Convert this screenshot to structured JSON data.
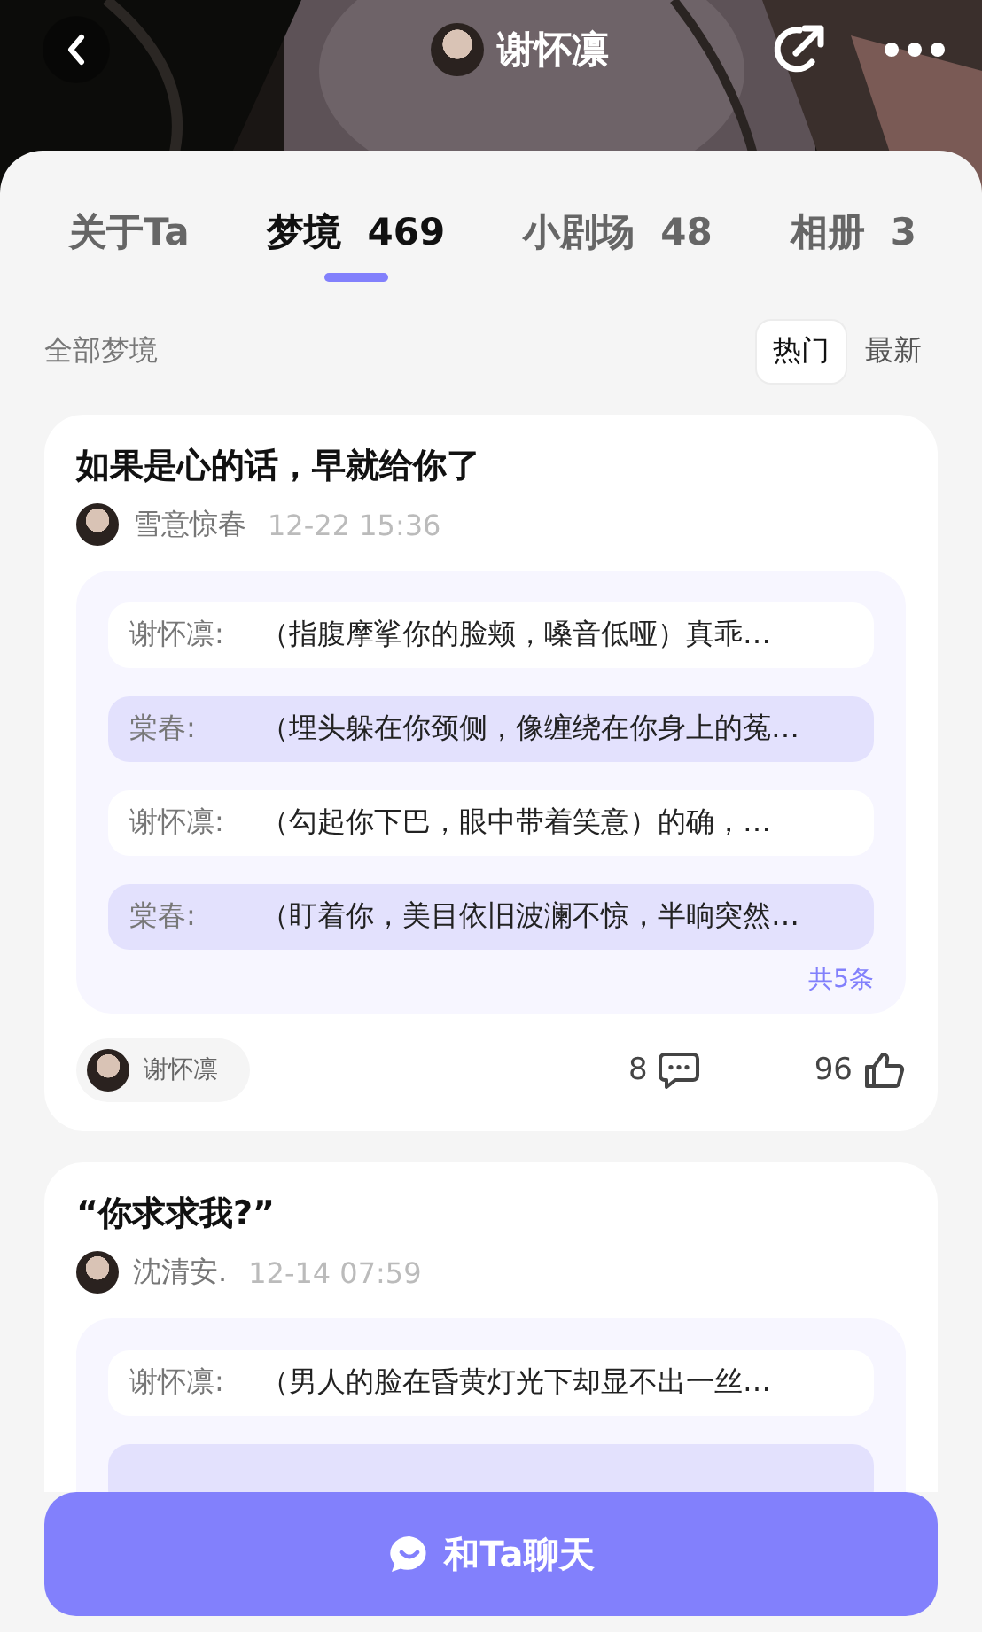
{
  "header": {
    "title": "谢怀凛"
  },
  "tabs": [
    {
      "label": "关于Ta",
      "selected": false
    },
    {
      "label": "梦境",
      "count": "469",
      "selected": true
    },
    {
      "label": "小剧场",
      "count": "48",
      "selected": false
    },
    {
      "label": "相册",
      "count": "3",
      "selected": false
    }
  ],
  "filter": {
    "label": "全部梦境",
    "sorts": [
      {
        "label": "热门",
        "selected": true
      },
      {
        "label": "最新",
        "selected": false
      }
    ]
  },
  "posts": [
    {
      "title": "如果是心的话，早就给你了",
      "author": "雪意惊春",
      "time": "12-22 15:36",
      "lines": [
        {
          "kind": "character",
          "speaker": "谢怀凛:",
          "text": "（指腹摩挲你的脸颊，嗓音低哑）真乖…"
        },
        {
          "kind": "user",
          "speaker": "棠春:",
          "text": "（埋头躲在你颈侧，像缠绕在你身上的菟…"
        },
        {
          "kind": "character",
          "speaker": "谢怀凛:",
          "text": "（勾起你下巴，眼中带着笑意）的确，…"
        },
        {
          "kind": "user",
          "speaker": "棠春:",
          "text": "（盯着你，美目依旧波澜不惊，半晌突然…"
        }
      ],
      "total": "共5条",
      "character": "谢怀凛",
      "comments": "8",
      "likes": "96"
    },
    {
      "title": "“你求求我?”",
      "author": "沈清安.",
      "time": "12-14 07:59",
      "lines": [
        {
          "kind": "character",
          "speaker": "谢怀凛:",
          "text": "（男人的脸在昏黄灯光下却显不出一丝…"
        },
        {
          "kind": "user"
        }
      ]
    }
  ],
  "chat_button": {
    "label": "和Ta聊天"
  }
}
